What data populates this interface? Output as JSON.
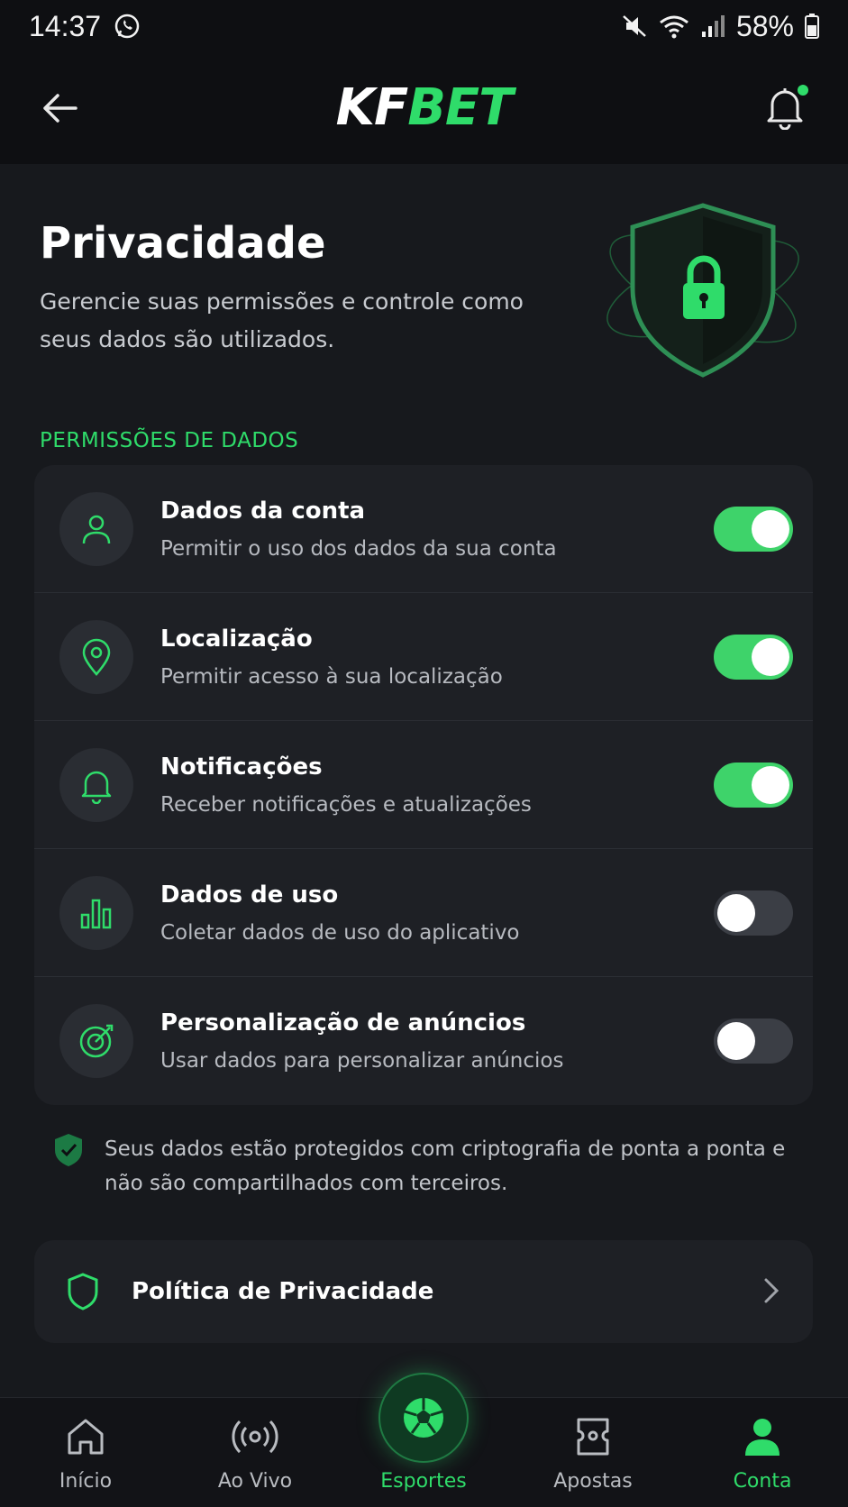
{
  "status_bar": {
    "time": "14:37",
    "battery": "58%"
  },
  "header": {
    "logo_part1": "KF",
    "logo_part2": "BET"
  },
  "hero": {
    "title": "Privacidade",
    "subtitle": "Gerencie suas permissões e controle como seus dados são utilizados."
  },
  "section_title": "PERMISSÕES DE DADOS",
  "permissions": [
    {
      "icon": "user-icon",
      "title": "Dados da conta",
      "desc": "Permitir o uso dos dados da sua conta",
      "enabled": true
    },
    {
      "icon": "location-pin-icon",
      "title": "Localização",
      "desc": "Permitir acesso à sua localização",
      "enabled": true
    },
    {
      "icon": "bell-icon",
      "title": "Notificações",
      "desc": "Receber notificações e atualizações",
      "enabled": true
    },
    {
      "icon": "bar-chart-icon",
      "title": "Dados de uso",
      "desc": "Coletar dados de uso do aplicativo",
      "enabled": false
    },
    {
      "icon": "target-icon",
      "title": "Personalização de anúncios",
      "desc": "Usar dados para personalizar anúncios",
      "enabled": false
    }
  ],
  "secure_note": "Seus dados estão protegidos com criptografia de ponta a ponta e não são compartilhados com terceiros.",
  "policy_label": "Política de Privacidade",
  "bottom_nav": [
    {
      "label": "Início",
      "icon": "home-icon",
      "active": false
    },
    {
      "label": "Ao Vivo",
      "icon": "live-broadcast-icon",
      "active": false
    },
    {
      "label": "Esportes",
      "icon": "soccer-ball-icon",
      "active": true
    },
    {
      "label": "Apostas",
      "icon": "ticket-icon",
      "active": false
    },
    {
      "label": "Conta",
      "icon": "account-icon",
      "active": true
    }
  ],
  "colors": {
    "accent": "#2fdc6a",
    "toggle_on": "#3ed36a",
    "background": "#17191d",
    "card": "#1e2025"
  }
}
